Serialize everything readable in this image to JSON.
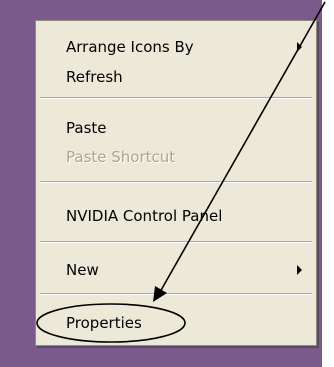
{
  "menu": {
    "items": [
      {
        "label": "Arrange Icons By",
        "has_submenu": true,
        "disabled": false
      },
      {
        "label": "Refresh",
        "has_submenu": false,
        "disabled": false
      },
      {
        "label": "Paste",
        "has_submenu": false,
        "disabled": false
      },
      {
        "label": "Paste Shortcut",
        "has_submenu": false,
        "disabled": true
      },
      {
        "label": "NVIDIA Control Panel",
        "has_submenu": false,
        "disabled": false
      },
      {
        "label": "New",
        "has_submenu": true,
        "disabled": false
      },
      {
        "label": "Properties",
        "has_submenu": false,
        "disabled": false
      }
    ]
  },
  "annotation": {
    "type": "arrow-and-ellipse",
    "highlighted_item": "Properties",
    "color": "#000000"
  },
  "colors": {
    "desktop": "#7a5a8c",
    "menu_bg": "#ece9d8",
    "disabled_text": "#a9a691"
  }
}
